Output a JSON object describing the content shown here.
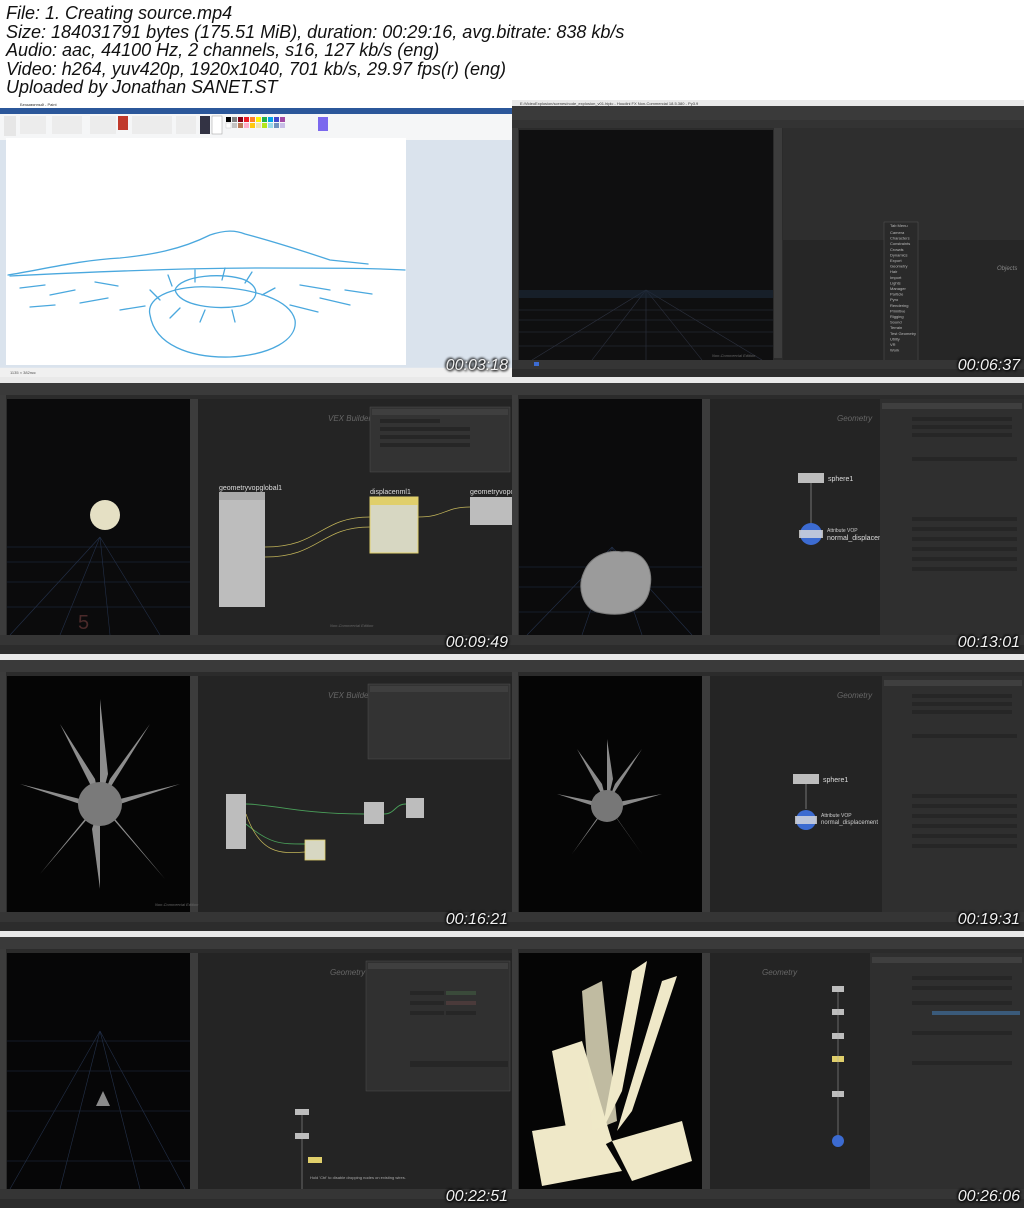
{
  "header": {
    "lines": [
      "File: 1. Creating source.mp4",
      "Size: 184031791 bytes (175.51 MiB), duration: 00:29:16, avg.bitrate: 838 kb/s",
      "Audio: aac, 44100 Hz, 2 channels, s16, 127 kb/s (eng)",
      "Video: h264, yuv420p, 1920x1040, 701 kb/s, 29.97 fps(r) (eng)",
      "Uploaded by Jonathan SANET.ST"
    ]
  },
  "thumbnails": [
    {
      "timestamp": "00:03:18"
    },
    {
      "timestamp": "00:06:37"
    },
    {
      "timestamp": "00:09:49"
    },
    {
      "timestamp": "00:13:01"
    },
    {
      "timestamp": "00:16:21"
    },
    {
      "timestamp": "00:19:31"
    },
    {
      "timestamp": "00:22:51"
    },
    {
      "timestamp": "00:26:06"
    }
  ],
  "labels": {
    "node_geometryvopglobal": "geometryvopglobal1",
    "node_displacenml": "displacenml1",
    "node_geometryvopout": "geometryvopou",
    "node_sphere": "sphere1",
    "node_normal_displacement": "normal_displacem",
    "node_normal_displacement_full": "normal_displacement",
    "node_attrib_vop": "Attribute VOP",
    "net_vex_builder": "VEX Builder",
    "net_geometry": "Geometry",
    "net_objects": "Objects",
    "watermark": "Non-Commercial Edition",
    "tab_menu_title": "Tab Menu",
    "tab_menu_items": [
      "Camera",
      "Characters",
      "Constraints",
      "Crowds",
      "Dynamics",
      "Export",
      "Geometry",
      "Hair",
      "Import",
      "Lights",
      "Manager",
      "Particle",
      "Pyro",
      "Rendering",
      "Primitive",
      "Rigging",
      "Sound",
      "Terrain",
      "Test Geometry",
      "Utility",
      "VR",
      "Work",
      "",
      "History"
    ],
    "paint_title": "Безымянный - Paint",
    "paint_status": "1135 × 382пкс",
    "houdini_title": "E:/VideoExplosion/scenes/node_explosion_v01.hiplc - Houdini FX Non-Commercial 18.5.380 - Py3.9",
    "hint_text": "Hold 'Ctrl' to disable dropping nodes on existing wires."
  },
  "colors": {
    "bg_dark": "#1f1f1f",
    "panel": "#3a3a3a",
    "sketch_stroke": "#4aa8de",
    "node_blue": "#3c6bd1",
    "node_yellow": "#e0cf6b",
    "accent_orange": "#f4a44b"
  }
}
